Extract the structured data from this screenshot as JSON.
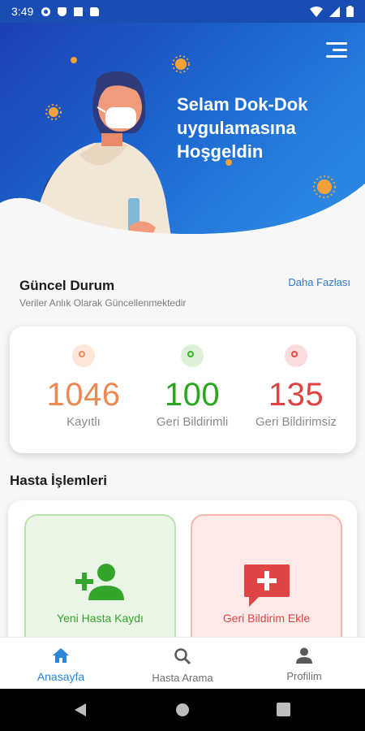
{
  "status_bar": {
    "time": "3:49"
  },
  "hero": {
    "title_lines": [
      "Selam Dok-Dok",
      "uygulamasına",
      "Hoşgeldin"
    ],
    "menu_icon": "hamburger-menu-icon"
  },
  "status_section": {
    "title": "Güncel Durum",
    "subtitle": "Veriler Anlık Olarak Güncellenmektedir",
    "more_link": "Daha Fazlası"
  },
  "stats": [
    {
      "value": "1046",
      "label": "Kayıtlı",
      "color": "#ec8a52"
    },
    {
      "value": "100",
      "label": "Geri Bildirimli",
      "color": "#2ba61f"
    },
    {
      "value": "135",
      "label": "Geri Bildirimsiz",
      "color": "#de4343"
    }
  ],
  "operations": {
    "title": "Hasta İşlemleri",
    "items": [
      {
        "label": "Yeni Hasta Kaydı",
        "icon": "add-user-icon",
        "color": "#34a52a"
      },
      {
        "label": "Geri Bildirim Ekle",
        "icon": "add-comment-icon",
        "color": "#e04545"
      }
    ]
  },
  "bottom_nav": [
    {
      "label": "Anasayfa",
      "icon": "home-icon",
      "active": true
    },
    {
      "label": "Hasta Arama",
      "icon": "search-icon",
      "active": false
    },
    {
      "label": "Profilim",
      "icon": "person-icon",
      "active": false
    }
  ],
  "colors": {
    "accent": "#2a86d8",
    "hero_blue": "#1a4db3"
  }
}
